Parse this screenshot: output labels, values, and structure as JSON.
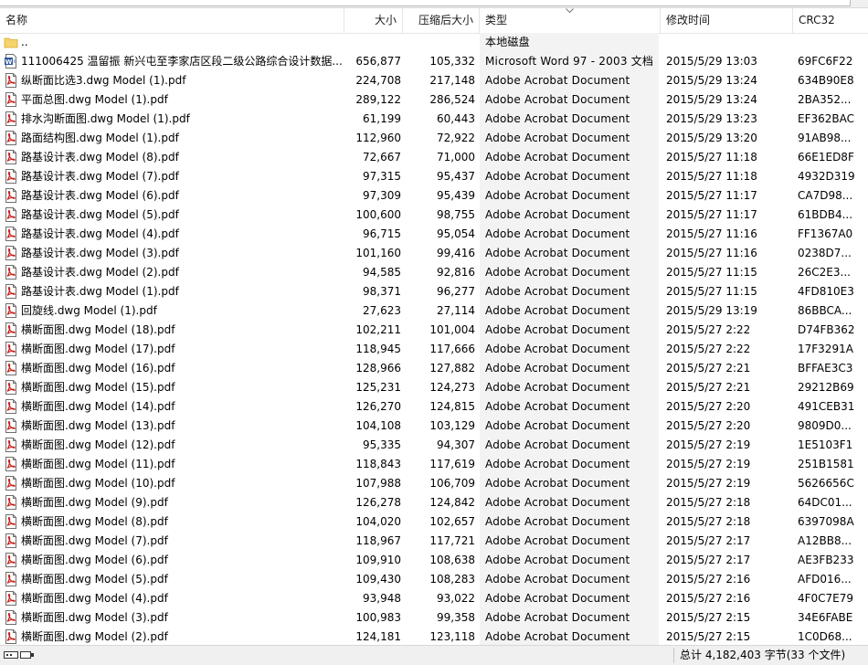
{
  "header": {
    "name": "名称",
    "size": "大小",
    "packed": "压缩后大小",
    "type": "类型",
    "mtime": "修改时间",
    "crc": "CRC32"
  },
  "colors": {
    "pdf_red": "#c8201c",
    "folder_yellow": "#f6d36b",
    "word_blue": "#2b579a",
    "type_column_bg": "#f3f3f3"
  },
  "rows": [
    {
      "icon": "folder-icon",
      "name": "..",
      "size": "",
      "packed": "",
      "type": "本地磁盘",
      "mtime": "",
      "crc": ""
    },
    {
      "icon": "word-doc-icon",
      "name": "111006425 温留振 新兴屯至李家店区段二级公路综合设计数据...",
      "size": "656,877",
      "packed": "105,332",
      "type": "Microsoft Word 97 - 2003 文档",
      "mtime": "2015/5/29 13:03",
      "crc": "69FC6F22"
    },
    {
      "icon": "pdf-icon",
      "name": "纵断面比选3.dwg Model (1).pdf",
      "size": "224,708",
      "packed": "217,148",
      "type": "Adobe Acrobat Document",
      "mtime": "2015/5/29 13:24",
      "crc": "634B90E8"
    },
    {
      "icon": "pdf-icon",
      "name": "平面总图.dwg Model (1).pdf",
      "size": "289,122",
      "packed": "286,524",
      "type": "Adobe Acrobat Document",
      "mtime": "2015/5/29 13:24",
      "crc": "2BA352..."
    },
    {
      "icon": "pdf-icon",
      "name": "排水沟断面图.dwg Model (1).pdf",
      "size": "61,199",
      "packed": "60,443",
      "type": "Adobe Acrobat Document",
      "mtime": "2015/5/29 13:23",
      "crc": "EF362BAC"
    },
    {
      "icon": "pdf-icon",
      "name": "路面结构图.dwg Model (1).pdf",
      "size": "112,960",
      "packed": "72,922",
      "type": "Adobe Acrobat Document",
      "mtime": "2015/5/29 13:20",
      "crc": "91AB98..."
    },
    {
      "icon": "pdf-icon",
      "name": "路基设计表.dwg Model (8).pdf",
      "size": "72,667",
      "packed": "71,000",
      "type": "Adobe Acrobat Document",
      "mtime": "2015/5/27 11:18",
      "crc": "66E1ED8F"
    },
    {
      "icon": "pdf-icon",
      "name": "路基设计表.dwg Model (7).pdf",
      "size": "97,315",
      "packed": "95,437",
      "type": "Adobe Acrobat Document",
      "mtime": "2015/5/27 11:18",
      "crc": "4932D319"
    },
    {
      "icon": "pdf-icon",
      "name": "路基设计表.dwg Model (6).pdf",
      "size": "97,309",
      "packed": "95,439",
      "type": "Adobe Acrobat Document",
      "mtime": "2015/5/27 11:17",
      "crc": "CA7D98..."
    },
    {
      "icon": "pdf-icon",
      "name": "路基设计表.dwg Model (5).pdf",
      "size": "100,600",
      "packed": "98,755",
      "type": "Adobe Acrobat Document",
      "mtime": "2015/5/27 11:17",
      "crc": "61BDB4..."
    },
    {
      "icon": "pdf-icon",
      "name": "路基设计表.dwg Model (4).pdf",
      "size": "96,715",
      "packed": "95,054",
      "type": "Adobe Acrobat Document",
      "mtime": "2015/5/27 11:16",
      "crc": "FF1367A0"
    },
    {
      "icon": "pdf-icon",
      "name": "路基设计表.dwg Model (3).pdf",
      "size": "101,160",
      "packed": "99,416",
      "type": "Adobe Acrobat Document",
      "mtime": "2015/5/27 11:16",
      "crc": "0238D7..."
    },
    {
      "icon": "pdf-icon",
      "name": "路基设计表.dwg Model (2).pdf",
      "size": "94,585",
      "packed": "92,816",
      "type": "Adobe Acrobat Document",
      "mtime": "2015/5/27 11:15",
      "crc": "26C2E3..."
    },
    {
      "icon": "pdf-icon",
      "name": "路基设计表.dwg Model (1).pdf",
      "size": "98,371",
      "packed": "96,277",
      "type": "Adobe Acrobat Document",
      "mtime": "2015/5/27 11:15",
      "crc": "4FD810E3"
    },
    {
      "icon": "pdf-icon",
      "name": "回旋线.dwg Model (1).pdf",
      "size": "27,623",
      "packed": "27,114",
      "type": "Adobe Acrobat Document",
      "mtime": "2015/5/29 13:19",
      "crc": "86BBCA..."
    },
    {
      "icon": "pdf-icon",
      "name": "横断面图.dwg Model (18).pdf",
      "size": "102,211",
      "packed": "101,004",
      "type": "Adobe Acrobat Document",
      "mtime": "2015/5/27 2:22",
      "crc": "D74FB362"
    },
    {
      "icon": "pdf-icon",
      "name": "横断面图.dwg Model (17).pdf",
      "size": "118,945",
      "packed": "117,666",
      "type": "Adobe Acrobat Document",
      "mtime": "2015/5/27 2:22",
      "crc": "17F3291A"
    },
    {
      "icon": "pdf-icon",
      "name": "横断面图.dwg Model (16).pdf",
      "size": "128,966",
      "packed": "127,882",
      "type": "Adobe Acrobat Document",
      "mtime": "2015/5/27 2:21",
      "crc": "BFFAE3C3"
    },
    {
      "icon": "pdf-icon",
      "name": "横断面图.dwg Model (15).pdf",
      "size": "125,231",
      "packed": "124,273",
      "type": "Adobe Acrobat Document",
      "mtime": "2015/5/27 2:21",
      "crc": "29212B69"
    },
    {
      "icon": "pdf-icon",
      "name": "横断面图.dwg Model (14).pdf",
      "size": "126,270",
      "packed": "124,815",
      "type": "Adobe Acrobat Document",
      "mtime": "2015/5/27 2:20",
      "crc": "491CEB31"
    },
    {
      "icon": "pdf-icon",
      "name": "横断面图.dwg Model (13).pdf",
      "size": "104,108",
      "packed": "103,129",
      "type": "Adobe Acrobat Document",
      "mtime": "2015/5/27 2:20",
      "crc": "9809D0..."
    },
    {
      "icon": "pdf-icon",
      "name": "横断面图.dwg Model (12).pdf",
      "size": "95,335",
      "packed": "94,307",
      "type": "Adobe Acrobat Document",
      "mtime": "2015/5/27 2:19",
      "crc": "1E5103F1"
    },
    {
      "icon": "pdf-icon",
      "name": "横断面图.dwg Model (11).pdf",
      "size": "118,843",
      "packed": "117,619",
      "type": "Adobe Acrobat Document",
      "mtime": "2015/5/27 2:19",
      "crc": "251B1581"
    },
    {
      "icon": "pdf-icon",
      "name": "横断面图.dwg Model (10).pdf",
      "size": "107,988",
      "packed": "106,709",
      "type": "Adobe Acrobat Document",
      "mtime": "2015/5/27 2:19",
      "crc": "5626656C"
    },
    {
      "icon": "pdf-icon",
      "name": "横断面图.dwg Model (9).pdf",
      "size": "126,278",
      "packed": "124,842",
      "type": "Adobe Acrobat Document",
      "mtime": "2015/5/27 2:18",
      "crc": "64DC01..."
    },
    {
      "icon": "pdf-icon",
      "name": "横断面图.dwg Model (8).pdf",
      "size": "104,020",
      "packed": "102,657",
      "type": "Adobe Acrobat Document",
      "mtime": "2015/5/27 2:18",
      "crc": "6397098A"
    },
    {
      "icon": "pdf-icon",
      "name": "横断面图.dwg Model (7).pdf",
      "size": "118,967",
      "packed": "117,721",
      "type": "Adobe Acrobat Document",
      "mtime": "2015/5/27 2:17",
      "crc": "A12BB8..."
    },
    {
      "icon": "pdf-icon",
      "name": "横断面图.dwg Model (6).pdf",
      "size": "109,910",
      "packed": "108,638",
      "type": "Adobe Acrobat Document",
      "mtime": "2015/5/27 2:17",
      "crc": "AE3FB233"
    },
    {
      "icon": "pdf-icon",
      "name": "横断面图.dwg Model (5).pdf",
      "size": "109,430",
      "packed": "108,283",
      "type": "Adobe Acrobat Document",
      "mtime": "2015/5/27 2:16",
      "crc": "AFD016..."
    },
    {
      "icon": "pdf-icon",
      "name": "横断面图.dwg Model (4).pdf",
      "size": "93,948",
      "packed": "93,022",
      "type": "Adobe Acrobat Document",
      "mtime": "2015/5/27 2:16",
      "crc": "4F0C7E79"
    },
    {
      "icon": "pdf-icon",
      "name": "横断面图.dwg Model (3).pdf",
      "size": "100,983",
      "packed": "99,358",
      "type": "Adobe Acrobat Document",
      "mtime": "2015/5/27 2:15",
      "crc": "34E6FABE"
    },
    {
      "icon": "pdf-icon",
      "name": "横断面图.dwg Model (2).pdf",
      "size": "124,181",
      "packed": "123,118",
      "type": "Adobe Acrobat Document",
      "mtime": "2015/5/27 2:15",
      "crc": "1C0D68..."
    }
  ],
  "statusbar": {
    "left_icons": "drive-icon",
    "summary": "总计 4,182,403 字节(33 个文件)"
  }
}
